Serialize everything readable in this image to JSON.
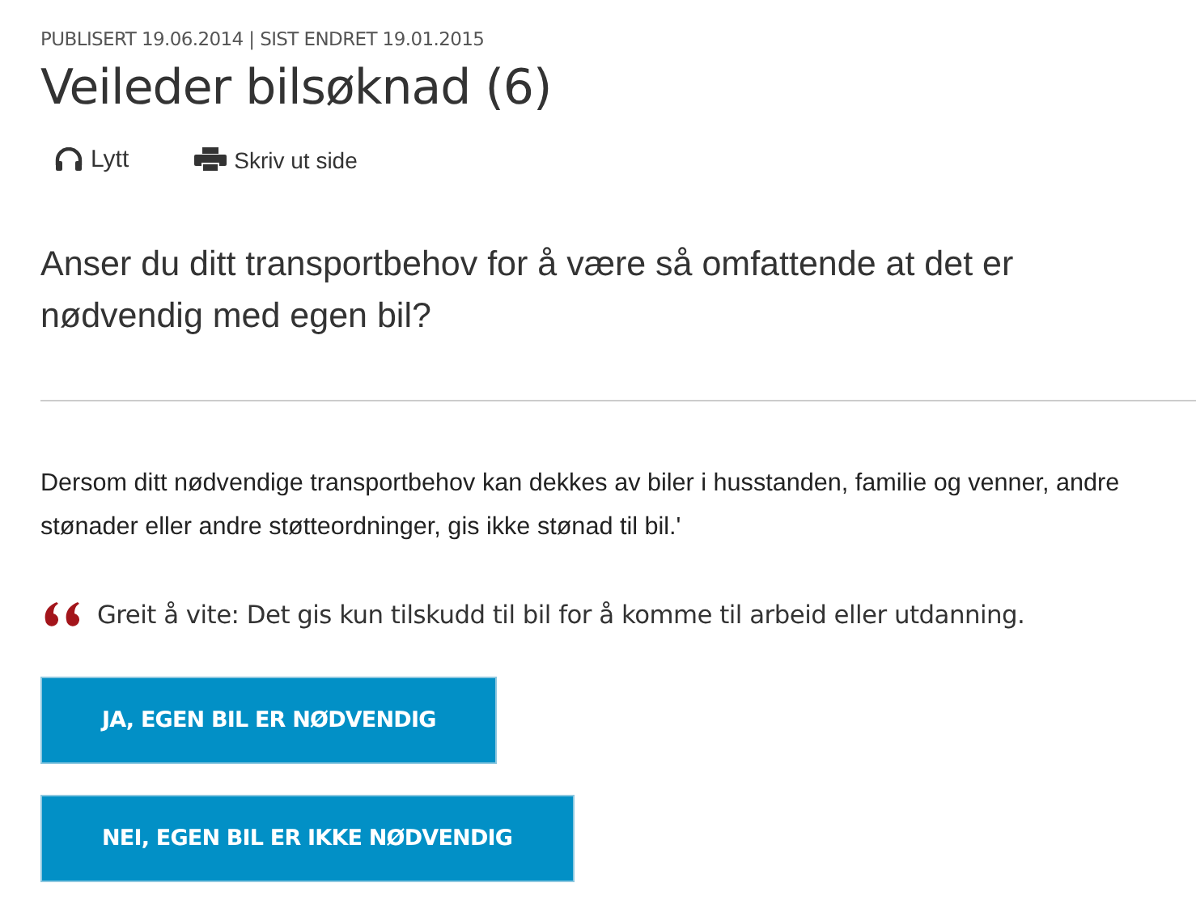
{
  "meta": "PUBLISERT 19.06.2014 | SIST ENDRET 19.01.2015",
  "title": "Veileder bilsøknad (6)",
  "tools": [
    {
      "kind": "listen",
      "label": "Lytt"
    },
    {
      "kind": "print",
      "label": "Skriv ut side"
    }
  ],
  "question": "Anser du ditt transportbehov for å være så omfattende at det er nødvendig med egen bil?",
  "body": "Dersom ditt nødvendige transportbehov kan dekkes av biler i husstanden, familie og venner, andre stønader eller andre støtteordninger, gis ikke stønad til bil.'",
  "quote": "Greit å vite: Det gis kun tilskudd til bil for å komme til arbeid eller utdanning.",
  "buttons": [
    "JA, EGEN BIL ER NØDVENDIG",
    "NEI, EGEN BIL ER IKKE NØDVENDIG"
  ]
}
